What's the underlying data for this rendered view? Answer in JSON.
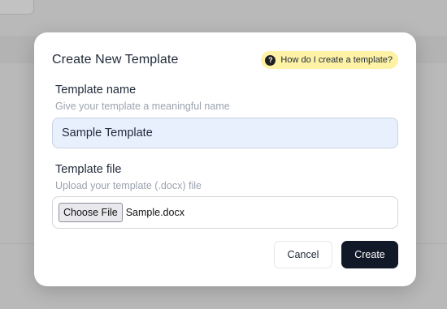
{
  "dialog": {
    "title": "Create New Template",
    "help_text": "How do I create a template?",
    "help_icon": "question-circle-icon"
  },
  "template_name": {
    "label": "Template name",
    "hint": "Give your template a meaningful name",
    "value": "Sample Template"
  },
  "template_file": {
    "label": "Template file",
    "hint": "Upload your template (.docx) file",
    "button_label": "Choose File",
    "file_name": "Sample.docx"
  },
  "actions": {
    "cancel_label": "Cancel",
    "create_label": "Create"
  },
  "colors": {
    "help_pill_bg": "#fdf2a6",
    "input_bg": "#e8f0fe",
    "primary_button_bg": "#111827",
    "overlay": "#b9b9b9"
  }
}
